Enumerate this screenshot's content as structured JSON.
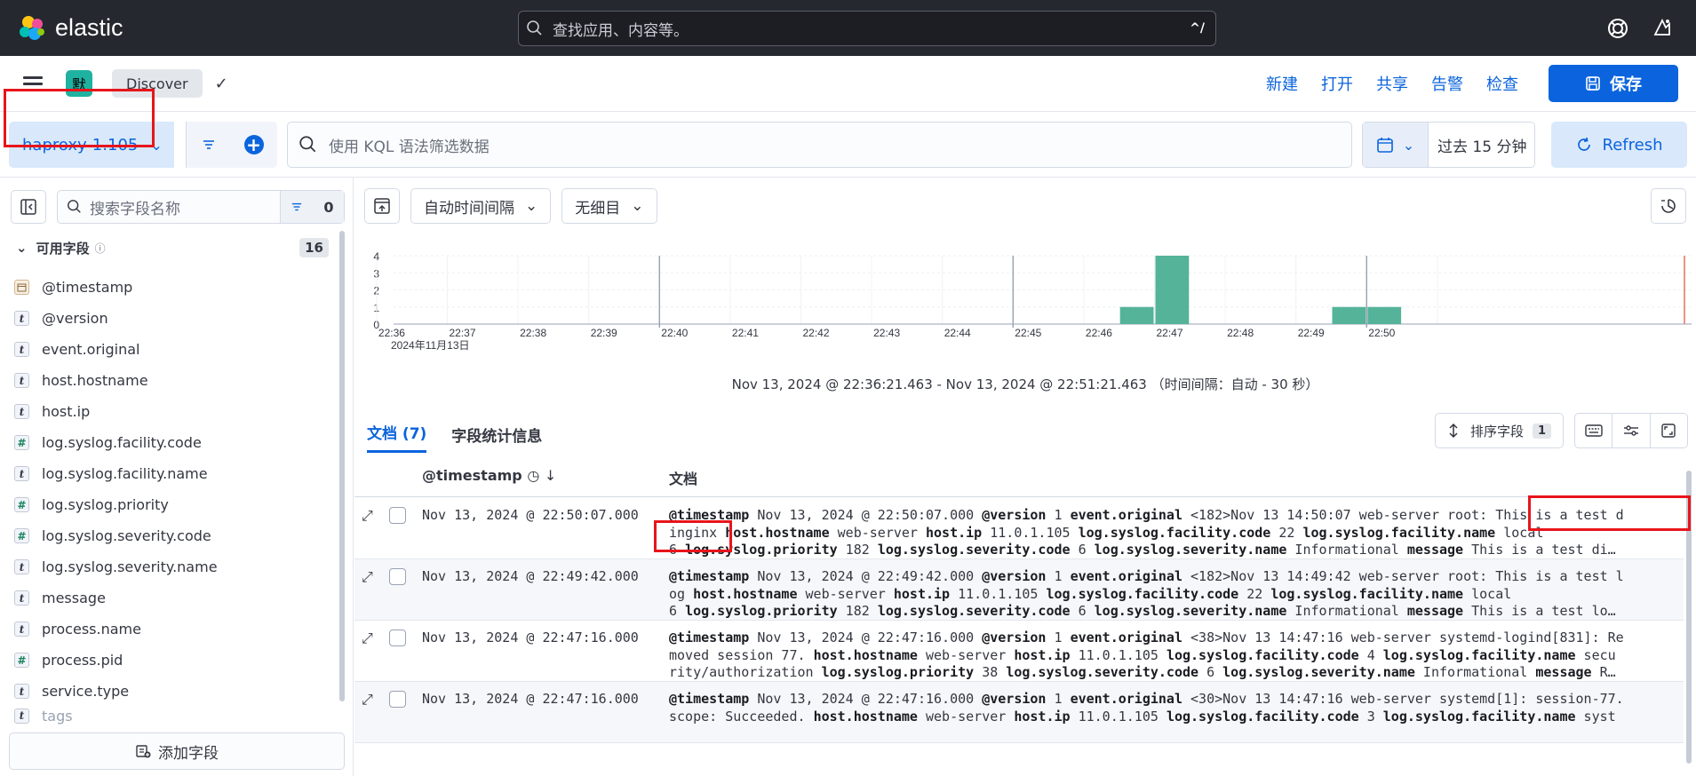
{
  "topbar": {
    "brand": "elastic",
    "search_placeholder": "查找应用、内容等。",
    "search_shortcut": "^/"
  },
  "appbar": {
    "space_initial": "默",
    "breadcrumb": "Discover",
    "links": [
      "新建",
      "打开",
      "共享",
      "告警",
      "检查"
    ],
    "save_label": "保存"
  },
  "querybar": {
    "data_view": "haproxy-1.105",
    "kql_placeholder": "使用 KQL 语法筛选数据",
    "time_range": "过去 15 分钟",
    "refresh_label": "Refresh"
  },
  "sidebar": {
    "search_placeholder": "搜索字段名称",
    "filter_count": "0",
    "available_label": "可用字段",
    "available_count": "16",
    "fields": [
      {
        "name": "@timestamp",
        "type": "date"
      },
      {
        "name": "@version",
        "type": "t"
      },
      {
        "name": "event.original",
        "type": "t"
      },
      {
        "name": "host.hostname",
        "type": "t"
      },
      {
        "name": "host.ip",
        "type": "t"
      },
      {
        "name": "log.syslog.facility.code",
        "type": "#"
      },
      {
        "name": "log.syslog.facility.name",
        "type": "t"
      },
      {
        "name": "log.syslog.priority",
        "type": "#"
      },
      {
        "name": "log.syslog.severity.code",
        "type": "#"
      },
      {
        "name": "log.syslog.severity.name",
        "type": "t"
      },
      {
        "name": "message",
        "type": "t"
      },
      {
        "name": "process.name",
        "type": "t"
      },
      {
        "name": "process.pid",
        "type": "#"
      },
      {
        "name": "service.type",
        "type": "t"
      },
      {
        "name": "tags",
        "type": "t"
      }
    ],
    "add_field_label": "添加字段"
  },
  "toolbar": {
    "interval_label": "自动时间间隔",
    "breakdown_label": "无细目"
  },
  "chart_data": {
    "type": "bar",
    "x_ticks": [
      "22:36",
      "22:37",
      "22:38",
      "22:39",
      "22:40",
      "22:41",
      "22:42",
      "22:43",
      "22:44",
      "22:45",
      "22:46",
      "22:47",
      "22:48",
      "22:49",
      "22:50"
    ],
    "x_sublabel": "2024年11月13日",
    "y_ticks": [
      "0",
      "1",
      "2",
      "3",
      "4"
    ],
    "ylim": [
      0,
      4
    ],
    "bars": [
      {
        "start": "22:46:30",
        "value": 1
      },
      {
        "start": "22:47:00",
        "value": 4
      },
      {
        "start": "22:49:30",
        "value": 1
      },
      {
        "start": "22:50:00",
        "value": 1
      }
    ],
    "bar_color": "#54b399"
  },
  "time_range_text": "Nov 13, 2024 @ 22:36:21.463 - Nov 13, 2024 @ 22:51:21.463 （时间间隔：自动 - 30 秒）",
  "tabs": {
    "documents": "文档 (7)",
    "field_stats": "字段统计信息"
  },
  "grid": {
    "sort_label": "排序字段",
    "sort_count": "1",
    "col_timestamp": "@timestamp",
    "col_document": "文档",
    "rows": [
      {
        "ts": "Nov 13, 2024 @ 22:50:07.000",
        "l1": [
          [
            "@timestamp",
            " Nov 13, 2024 @ 22:50:07.000 "
          ],
          [
            "@version",
            " 1 "
          ],
          [
            "event.original",
            " <182>Nov 13 14:50:07 web-server root: This is a test d"
          ]
        ],
        "l2": [
          [
            "",
            "inginx "
          ],
          [
            "host.hostname",
            " web-server "
          ],
          [
            "host.ip",
            " 11.0.1.105 "
          ],
          [
            "log.syslog.facility.code",
            " 22 "
          ],
          [
            "log.syslog.facility.name",
            " local"
          ]
        ],
        "l3": [
          [
            "",
            "6 "
          ],
          [
            "log.syslog.priority",
            " 182 "
          ],
          [
            "log.syslog.severity.code",
            " 6 "
          ],
          [
            "log.syslog.severity.name",
            " Informational "
          ],
          [
            "message",
            " This is a test di…"
          ]
        ]
      },
      {
        "ts": "Nov 13, 2024 @ 22:49:42.000",
        "l1": [
          [
            "@timestamp",
            " Nov 13, 2024 @ 22:49:42.000 "
          ],
          [
            "@version",
            " 1 "
          ],
          [
            "event.original",
            " <182>Nov 13 14:49:42 web-server root: This is a test l"
          ]
        ],
        "l2": [
          [
            "",
            "og "
          ],
          [
            "host.hostname",
            " web-server "
          ],
          [
            "host.ip",
            " 11.0.1.105 "
          ],
          [
            "log.syslog.facility.code",
            " 22 "
          ],
          [
            "log.syslog.facility.name",
            " local"
          ]
        ],
        "l3": [
          [
            "",
            "6 "
          ],
          [
            "log.syslog.priority",
            " 182 "
          ],
          [
            "log.syslog.severity.code",
            " 6 "
          ],
          [
            "log.syslog.severity.name",
            " Informational "
          ],
          [
            "message",
            " This is a test lo…"
          ]
        ]
      },
      {
        "ts": "Nov 13, 2024 @ 22:47:16.000",
        "l1": [
          [
            "@timestamp",
            " Nov 13, 2024 @ 22:47:16.000 "
          ],
          [
            "@version",
            " 1 "
          ],
          [
            "event.original",
            " <38>Nov 13 14:47:16 web-server systemd-logind[831]: Re"
          ]
        ],
        "l2": [
          [
            "",
            "moved session 77. "
          ],
          [
            "host.hostname",
            " web-server "
          ],
          [
            "host.ip",
            " 11.0.1.105 "
          ],
          [
            "log.syslog.facility.code",
            " 4 "
          ],
          [
            "log.syslog.facility.name",
            " secu"
          ]
        ],
        "l3": [
          [
            "",
            "rity/authorization "
          ],
          [
            "log.syslog.priority",
            " 38 "
          ],
          [
            "log.syslog.severity.code",
            " 6 "
          ],
          [
            "log.syslog.severity.name",
            " Informational "
          ],
          [
            "message",
            " R…"
          ]
        ]
      },
      {
        "ts": "Nov 13, 2024 @ 22:47:16.000",
        "l1": [
          [
            "@timestamp",
            " Nov 13, 2024 @ 22:47:16.000 "
          ],
          [
            "@version",
            " 1 "
          ],
          [
            "event.original",
            " <30>Nov 13 14:47:16 web-server systemd[1]: session-77."
          ]
        ],
        "l2": [
          [
            "",
            "scope: Succeeded. "
          ],
          [
            "host.hostname",
            " web-server "
          ],
          [
            "host.ip",
            " 11.0.1.105 "
          ],
          [
            "log.syslog.facility.code",
            " 3 "
          ],
          [
            "log.syslog.facility.name",
            " syst"
          ]
        ],
        "l3": []
      }
    ]
  }
}
